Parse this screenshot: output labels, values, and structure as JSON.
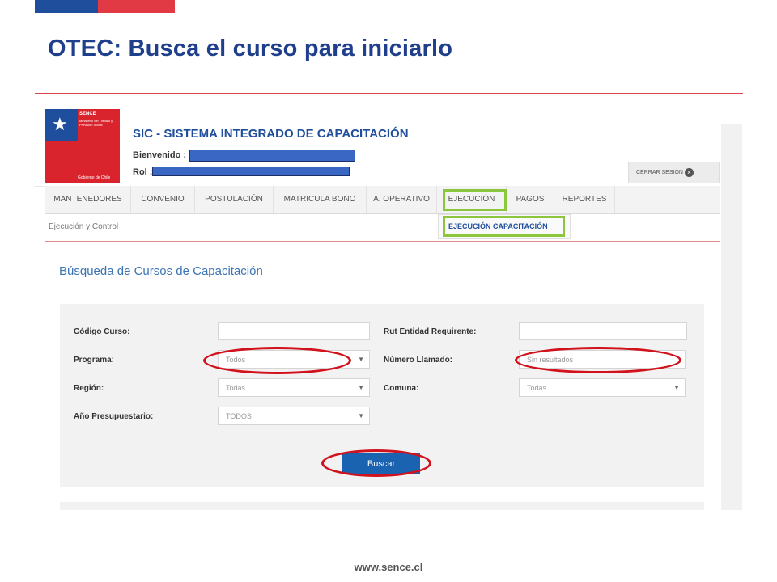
{
  "slide": {
    "title": "OTEC: Busca el curso para iniciarlo",
    "footer_url": "www.sence.cl"
  },
  "header": {
    "logo_name": "SENCE",
    "logo_subtitle": "Ministerio del Trabajo y Previsión Social",
    "logo_gov": "Gobierno de Chile",
    "system_title": "SIC - SISTEMA INTEGRADO DE CAPACITACIÓN",
    "welcome_label": "Bienvenido :",
    "rol_label": "Rol :",
    "logout_label": "CERRAR SESIÓN"
  },
  "nav": {
    "items": [
      "MANTENEDORES",
      "CONVENIO",
      "POSTULACIÓN",
      "MATRICULA BONO",
      "A. OPERATIVO",
      "EJECUCIÓN",
      "PAGOS",
      "REPORTES"
    ],
    "active": "EJECUCIÓN"
  },
  "subnav": {
    "breadcrumb": "Ejecución y Control",
    "submenu_item": "EJECUCIÓN CAPACITACIÓN"
  },
  "search": {
    "heading": "Búsqueda de Cursos de Capacitación",
    "fields": {
      "codigo_curso": {
        "label": "Código Curso:",
        "value": ""
      },
      "rut_entidad": {
        "label": "Rut Entidad Requirente:",
        "value": ""
      },
      "programa": {
        "label": "Programa:",
        "value": "Todos"
      },
      "numero_llamado": {
        "label": "Número Llamado:",
        "value": "Sin resultados"
      },
      "region": {
        "label": "Región:",
        "value": "Todas"
      },
      "comuna": {
        "label": "Comuna:",
        "value": "Todas"
      },
      "anio": {
        "label": "Año Presupuestario:",
        "value": "TODOS"
      }
    },
    "button": "Buscar"
  },
  "colors": {
    "brand_blue": "#1f4e9c",
    "brand_red": "#d9232d",
    "highlight_green": "#8cc63f",
    "annotation_red": "#d1121c",
    "button_blue": "#1a63b0"
  }
}
